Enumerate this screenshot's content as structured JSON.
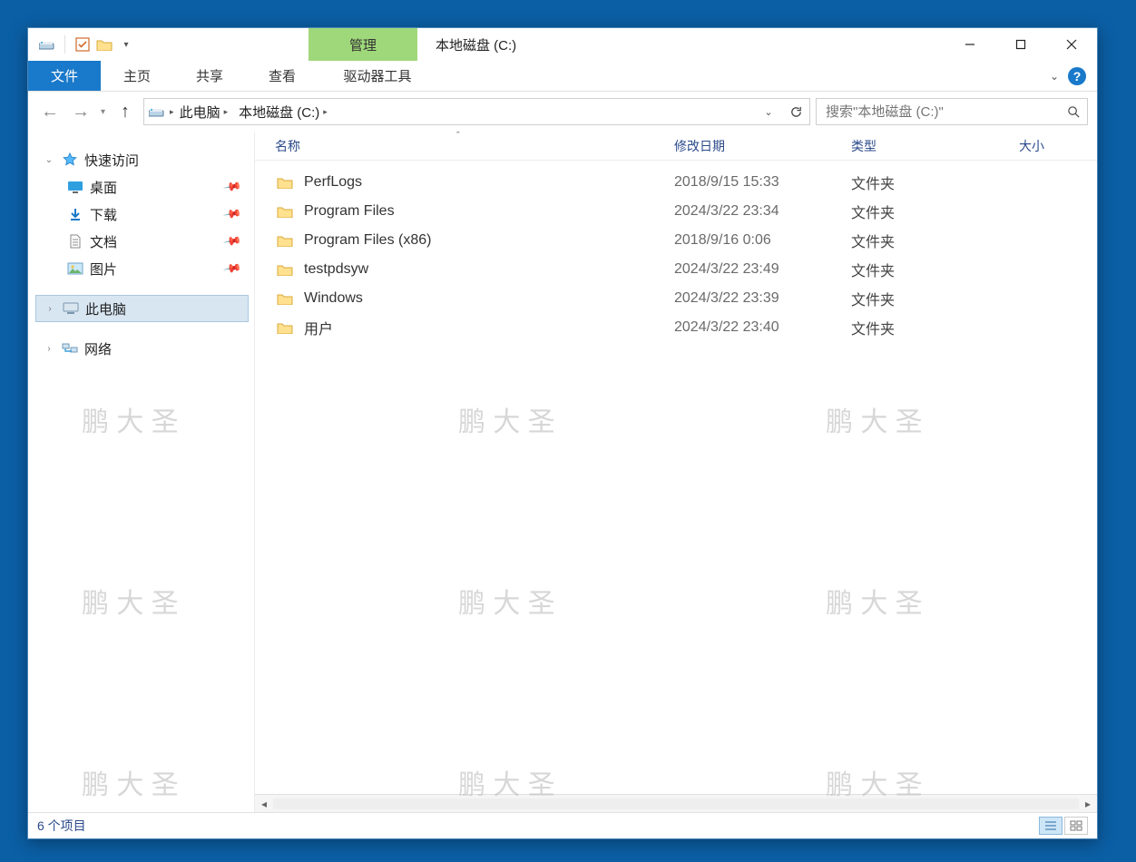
{
  "titlebar": {
    "manage_label": "管理",
    "window_title": "本地磁盘 (C:)"
  },
  "ribbon": {
    "file": "文件",
    "tabs": [
      "主页",
      "共享",
      "查看",
      "驱动器工具"
    ]
  },
  "address": {
    "segments": [
      "此电脑",
      "本地磁盘 (C:)"
    ]
  },
  "search": {
    "placeholder": "搜索\"本地磁盘 (C:)\""
  },
  "nav": {
    "quick_access": "快速访问",
    "desktop": "桌面",
    "downloads": "下载",
    "documents": "文档",
    "pictures": "图片",
    "this_pc": "此电脑",
    "network": "网络"
  },
  "columns": {
    "name": "名称",
    "date": "修改日期",
    "type": "类型",
    "size": "大小"
  },
  "files": [
    {
      "name": "PerfLogs",
      "date": "2018/9/15 15:33",
      "type": "文件夹",
      "size": ""
    },
    {
      "name": "Program Files",
      "date": "2024/3/22 23:34",
      "type": "文件夹",
      "size": ""
    },
    {
      "name": "Program Files (x86)",
      "date": "2018/9/16 0:06",
      "type": "文件夹",
      "size": ""
    },
    {
      "name": "testpdsyw",
      "date": "2024/3/22 23:49",
      "type": "文件夹",
      "size": ""
    },
    {
      "name": "Windows",
      "date": "2024/3/22 23:39",
      "type": "文件夹",
      "size": ""
    },
    {
      "name": "用户",
      "date": "2024/3/22 23:40",
      "type": "文件夹",
      "size": ""
    }
  ],
  "status": {
    "item_count": "6 个项目"
  },
  "watermark_text": "鹏 大 圣"
}
